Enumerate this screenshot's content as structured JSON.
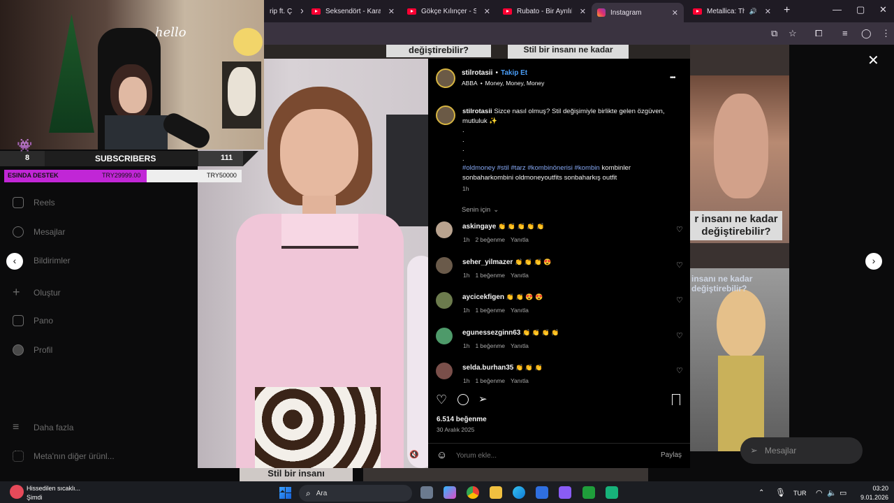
{
  "browser": {
    "tabs": [
      {
        "label": "rip ft. Ç",
        "icon": "youtube-icon"
      },
      {
        "label": "Seksendört - Kara G",
        "icon": "youtube-icon"
      },
      {
        "label": "Gökçe Kılınçer - Sev",
        "icon": "youtube-icon"
      },
      {
        "label": "Rubato - Bir Ayrılık, B",
        "icon": "youtube-icon"
      },
      {
        "label": "Instagram",
        "icon": "instagram-icon"
      },
      {
        "label": "Metallica: The Ur",
        "icon": "youtube-icon"
      }
    ],
    "close_glyph": "✕",
    "new_tab_glyph": "+",
    "window_controls": {
      "minimize": "—",
      "maximize": "▢",
      "close": "✕"
    }
  },
  "overlay": {
    "cam_text": "hello",
    "subscribers_count": "8",
    "subscribers_label": "SUBSCRIBERS",
    "subscribers_goal": "111",
    "donation_label": "ESINDA DESTEK",
    "donation_current": "TRY29999.00",
    "donation_goal": "TRY50000"
  },
  "sidebar": {
    "items": [
      {
        "label": "Reels",
        "icon": "reels-icon"
      },
      {
        "label": "Mesajlar",
        "icon": "messages-icon"
      },
      {
        "label": "Bildirimler",
        "icon": "heart-icon"
      },
      {
        "label": "Oluştur",
        "icon": "plus-icon"
      },
      {
        "label": "Pano",
        "icon": "dashboard-icon"
      },
      {
        "label": "Profil",
        "icon": "profile-icon"
      },
      {
        "label": "Daha fazla",
        "icon": "menu-icon"
      },
      {
        "label": "Meta'nın diğer ürünl...",
        "icon": "grid-icon"
      }
    ]
  },
  "background_tiles": {
    "top_caption_1": "değiştirebilir?",
    "top_caption_2": "Stil bir insanı ne kadar",
    "right_caption": "r insanı ne kadar değiştirebilir?",
    "right_caption_2": "insanı ne kadar değiştirebilir?",
    "bottom_caption": "Stil bir insanı",
    "messages_pill": "Mesajlar"
  },
  "post": {
    "username": "stilrotasii",
    "follow": "Takip Et",
    "dot": "•",
    "audio_artist": "ABBA",
    "audio_track": "Money, Money, Money",
    "caption_user": "stilrotasii",
    "caption_text": "Sizce nasıl olmuş? Stil değişimiyle birlikte gelen özgüven, mutluluk ✨",
    "caption_dots": ".\n.\n.\n.",
    "hashtags": "#oldmoney #stil #tarz #kombinönerisi #kombin",
    "caption_tail": " kombinler sonbaharkombini oldmoneyoutfits sonbaharkış outfit",
    "caption_time": "1h",
    "sort_label": "Senin için",
    "likes": "6.514 beğenme",
    "date": "30 Aralık 2025",
    "comment_placeholder": "Yorum ekle...",
    "share_label": "Paylaş",
    "more_glyph": "•••"
  },
  "comments": [
    {
      "user": "askingaye",
      "text": "👏 👏 👏 👏 👏",
      "time": "1h",
      "likes": "2 beğenme",
      "reply": "Yanıtla",
      "avatar_color": "#b9a38f"
    },
    {
      "user": "seher_yilmazer",
      "text": "👏 👏 👏 😍",
      "time": "1h",
      "likes": "1 beğenme",
      "reply": "Yanıtla",
      "avatar_color": "#6a5a4a"
    },
    {
      "user": "aycicekfigen",
      "text": "👏 👏 😍 😍",
      "time": "1h",
      "likes": "1 beğenme",
      "reply": "Yanıtla",
      "avatar_color": "#6c7b4d"
    },
    {
      "user": "egunessezginn63",
      "text": "👏 👏 👏 👏",
      "time": "1h",
      "likes": "1 beğenme",
      "reply": "Yanıtla",
      "avatar_color": "#4e9a6a"
    },
    {
      "user": "selda.burhan35",
      "text": "👏 👏 👏",
      "time": "1h",
      "likes": "1 beğenme",
      "reply": "Yanıtla",
      "avatar_color": "#7a4f4a"
    }
  ],
  "taskbar": {
    "weather_title": "Hissedilen sıcaklı...",
    "weather_sub": "Şimdi",
    "search_label": "Ara",
    "lang": "TUR",
    "time": "03:20",
    "date": "9.01.2026"
  }
}
